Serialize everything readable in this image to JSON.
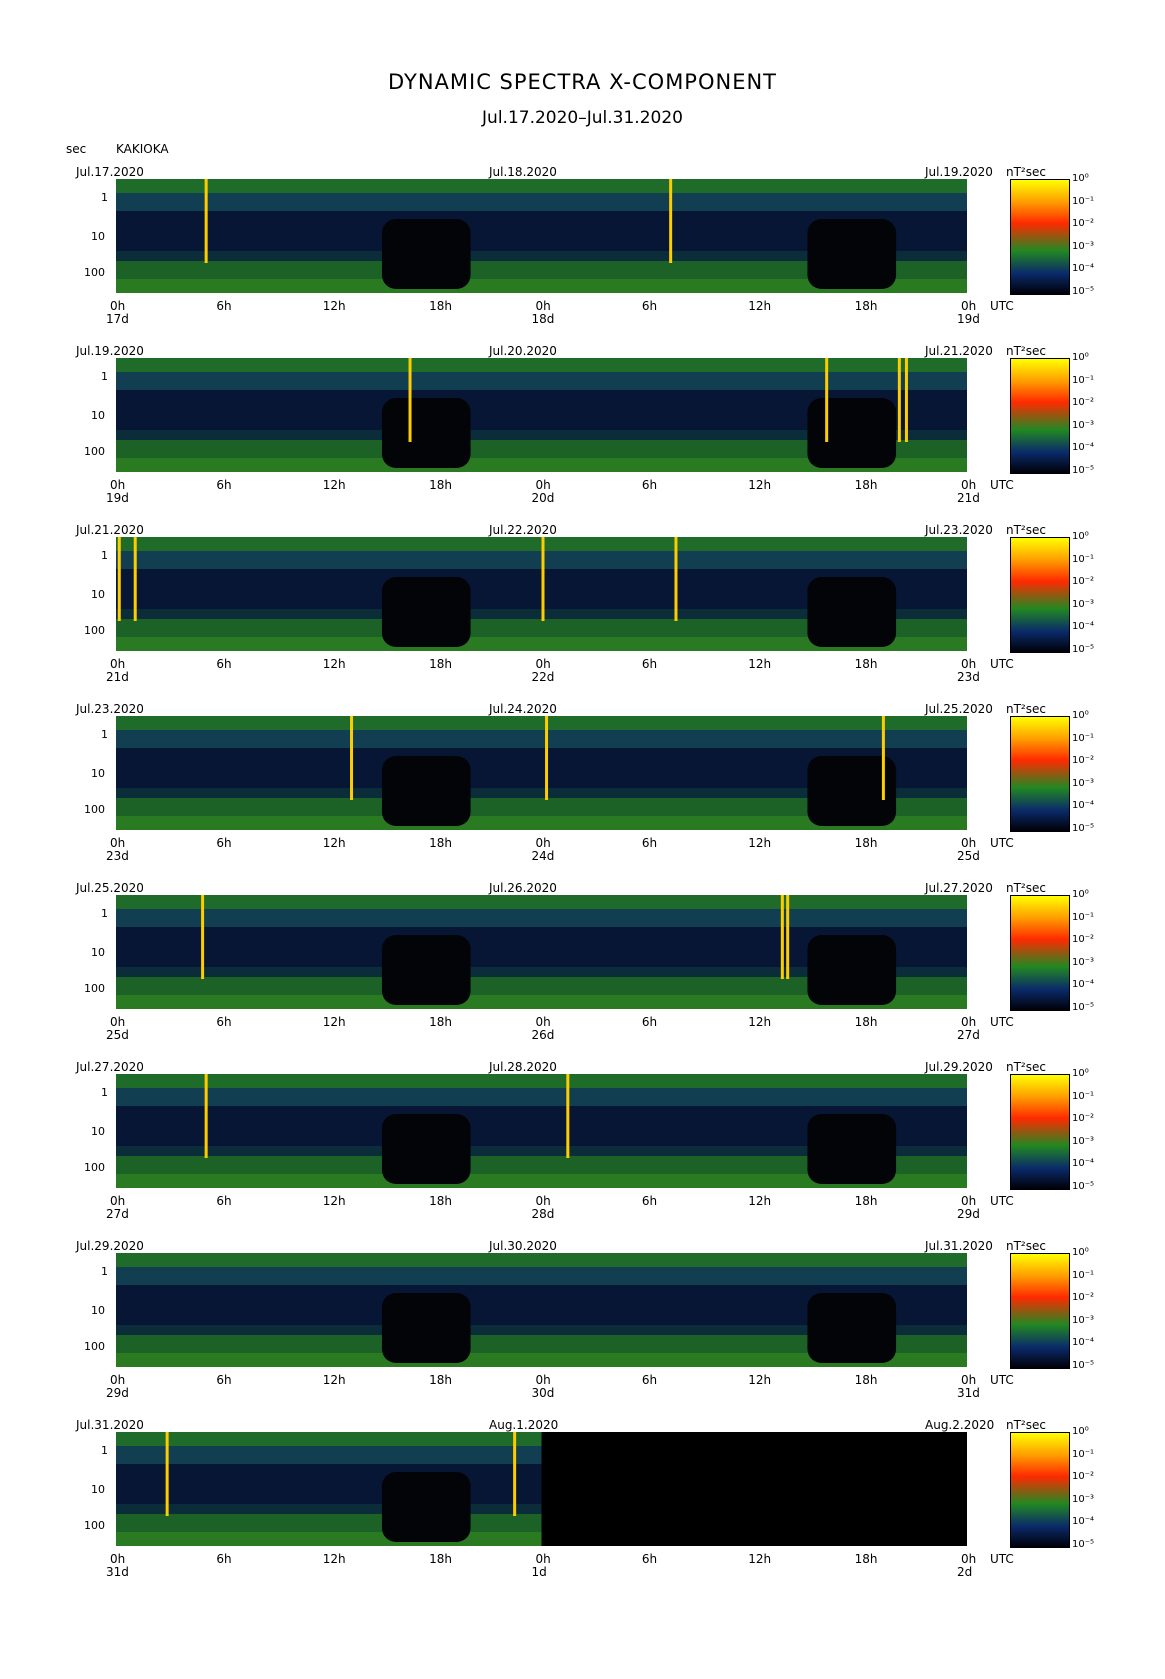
{
  "header": {
    "title": "DYNAMIC SPECTRA X-COMPONENT",
    "subtitle": "Jul.17.2020–Jul.31.2020",
    "unit_label": "sec",
    "station": "KAKIOKA"
  },
  "chart_data": {
    "type": "heatmap",
    "title": "DYNAMIC SPECTRA X-COMPONENT",
    "subtitle": "Jul.17.2020–Jul.31.2020",
    "ylabel": "sec",
    "y_ticks": [
      "1",
      "10",
      "100"
    ],
    "x_ticks": [
      "0h",
      "6h",
      "12h",
      "18h",
      "0h",
      "6h",
      "12h",
      "18h",
      "0h"
    ],
    "x_end_label": "UTC",
    "colorbar": {
      "label": "nT²sec",
      "ticks": [
        "10⁰",
        "10⁻¹",
        "10⁻²",
        "10⁻³",
        "10⁻⁴",
        "10⁻⁵"
      ],
      "colors": [
        "#ffff00",
        "#ff2a00",
        "#228822",
        "#0a2a6a",
        "#000008"
      ]
    },
    "panels": [
      {
        "date_left": "Jul.17.2020",
        "date_mid": "Jul.18.2020",
        "date_right": "Jul.19.2020",
        "day_labels": [
          "17d",
          "18d",
          "19d"
        ],
        "spikes_hours": [
          5,
          31.2
        ],
        "gaps_from_hour": null
      },
      {
        "date_left": "Jul.19.2020",
        "date_mid": "Jul.20.2020",
        "date_right": "Jul.21.2020",
        "day_labels": [
          "19d",
          "20d",
          "21d"
        ],
        "spikes_hours": [
          16.5,
          40,
          44.1,
          44.5
        ],
        "gaps_from_hour": null
      },
      {
        "date_left": "Jul.21.2020",
        "date_mid": "Jul.22.2020",
        "date_right": "Jul.23.2020",
        "day_labels": [
          "21d",
          "22d",
          "23d"
        ],
        "spikes_hours": [
          0.1,
          1,
          24,
          31.5
        ],
        "gaps_from_hour": null
      },
      {
        "date_left": "Jul.23.2020",
        "date_mid": "Jul.24.2020",
        "date_right": "Jul.25.2020",
        "day_labels": [
          "23d",
          "24d",
          "25d"
        ],
        "spikes_hours": [
          13.2,
          24.2,
          43.2
        ],
        "gaps_from_hour": null
      },
      {
        "date_left": "Jul.25.2020",
        "date_mid": "Jul.26.2020",
        "date_right": "Jul.27.2020",
        "day_labels": [
          "25d",
          "26d",
          "27d"
        ],
        "spikes_hours": [
          4.8,
          37.5,
          37.8
        ],
        "gaps_from_hour": null
      },
      {
        "date_left": "Jul.27.2020",
        "date_mid": "Jul.28.2020",
        "date_right": "Jul.29.2020",
        "day_labels": [
          "27d",
          "28d",
          "29d"
        ],
        "spikes_hours": [
          5,
          25.4
        ],
        "gaps_from_hour": null
      },
      {
        "date_left": "Jul.29.2020",
        "date_mid": "Jul.30.2020",
        "date_right": "Jul.31.2020",
        "day_labels": [
          "29d",
          "30d",
          "31d"
        ],
        "spikes_hours": [],
        "gaps_from_hour": null
      },
      {
        "date_left": "Jul.31.2020",
        "date_mid": "Aug.1.2020",
        "date_right": "Aug.2.2020",
        "day_labels": [
          "31d",
          "1d",
          "2d"
        ],
        "spikes_hours": [
          2.8,
          22.4
        ],
        "gaps_from_hour": 24
      }
    ]
  }
}
